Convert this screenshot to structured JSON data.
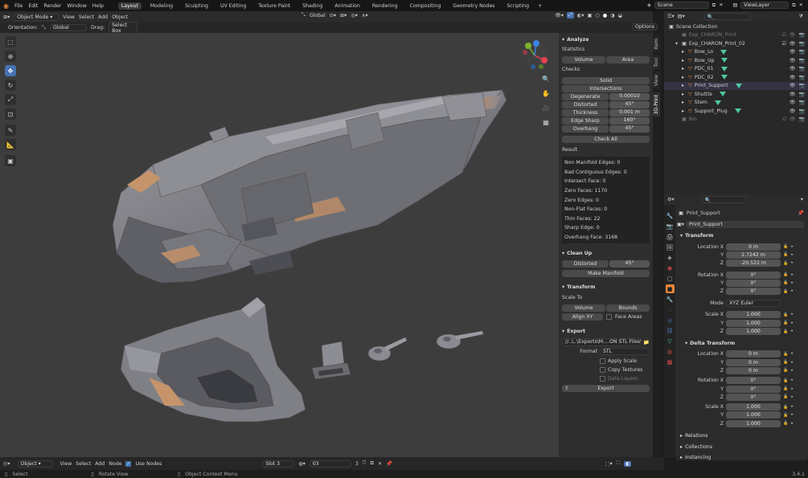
{
  "topbar": {
    "menu": [
      "File",
      "Edit",
      "Render",
      "Window",
      "Help"
    ],
    "workspaces": [
      "Layout",
      "Modeling",
      "Sculpting",
      "UV Editing",
      "Texture Paint",
      "Shading",
      "Animation",
      "Rendering",
      "Compositing",
      "Geometry Nodes",
      "Scripting"
    ],
    "active_workspace": "Layout",
    "add_tab": "+",
    "scene": "Scene",
    "view_layer": "ViewLayer"
  },
  "viewport_header": {
    "mode": "Object Mode",
    "menus": [
      "View",
      "Select",
      "Add",
      "Object"
    ],
    "transform_orientation": "Global"
  },
  "tool_header": {
    "orientation_label": "Orientation:",
    "orientation_value": "Global",
    "drag_label": "Drag:",
    "drag_value": "Select Box",
    "options": "Options"
  },
  "sidebar_tabs": [
    "Item",
    "Tool",
    "View",
    "3D-Print"
  ],
  "print3d": {
    "analyze_title": "Analyze",
    "statistics_label": "Statistics",
    "volume_btn": "Volume",
    "area_btn": "Area",
    "checks_label": "Checks",
    "solid_btn": "Solid",
    "intersections_btn": "Intersections",
    "checks": [
      {
        "label": "Degenerate",
        "value": "0.00010"
      },
      {
        "label": "Distorted",
        "value": "45°"
      },
      {
        "label": "Thickness",
        "value": "0.001 m"
      },
      {
        "label": "Edge Sharp",
        "value": "160°"
      },
      {
        "label": "Overhang",
        "value": "45°"
      }
    ],
    "check_all_btn": "Check All",
    "result_label": "Result",
    "results": [
      "Non Manifold Edges: 0",
      "Bad Contiguous Edges: 0",
      "Intersect Face: 0",
      "Zero Faces: 1170",
      "Zero Edges: 0",
      "Non-Flat Faces: 0",
      "Thin Faces: 22",
      "Sharp Edge: 0",
      "Overhang Face: 3168"
    ],
    "cleanup_title": "Clean Up",
    "distorted_label": "Distorted",
    "distorted_value": "45°",
    "make_manifold_btn": "Make Manifold",
    "transform_title": "Transform",
    "scale_to_label": "Scale To",
    "scale_volume_btn": "Volume",
    "scale_bounds_btn": "Bounds",
    "align_xy_btn": "Align XY",
    "face_areas_label": "Face Areas",
    "export_title": "Export",
    "export_path": "//..\\..\\Exports\\M....ON STL Files\\02\\",
    "format_label": "Format",
    "format_value": "STL",
    "apply_scale_label": "Apply Scale",
    "copy_textures_label": "Copy Textures",
    "data_layers_label": "Data Layers",
    "export_btn": "Export"
  },
  "outliner": {
    "root": "Scene Collection",
    "items": [
      {
        "label": "Exp_CHARON_Print",
        "level": 1,
        "dim": true
      },
      {
        "label": "Exp_CHARON_Print_02",
        "level": 1,
        "dim": false
      },
      {
        "label": "Bow_Lo",
        "level": 2,
        "dim": false
      },
      {
        "label": "Bow_Up",
        "level": 2,
        "dim": false
      },
      {
        "label": "PDC_01",
        "level": 2,
        "dim": false
      },
      {
        "label": "PDC_02",
        "level": 2,
        "dim": false
      },
      {
        "label": "Print_Support",
        "level": 2,
        "dim": false
      },
      {
        "label": "Shuttle",
        "level": 2,
        "dim": false
      },
      {
        "label": "Stem",
        "level": 2,
        "dim": false
      },
      {
        "label": "Support_Plug",
        "level": 2,
        "dim": false
      },
      {
        "label": "Bin",
        "level": 1,
        "dim": true
      }
    ]
  },
  "properties": {
    "object_name": "Print_Support",
    "object_name_field": "Print_Support",
    "transform_title": "Transform",
    "location_x_label": "Location X",
    "location": [
      "0 m",
      "2.7242 m",
      "-20.522 m"
    ],
    "rotation_x_label": "Rotation X",
    "rotation": [
      "0°",
      "0°",
      "0°"
    ],
    "mode_label": "Mode",
    "mode_value": "XYZ Euler",
    "scale_x_label": "Scale X",
    "scale": [
      "1.000",
      "1.000",
      "1.000"
    ],
    "delta_transform_title": "Delta Transform",
    "delta_location": [
      "0 m",
      "0 m",
      "0 m"
    ],
    "delta_rotation": [
      "0°",
      "0°",
      "0°"
    ],
    "delta_scale": [
      "1.000",
      "1.000",
      "1.000"
    ],
    "y_label": "Y",
    "z_label": "Z",
    "relations_title": "Relations",
    "collections_title": "Collections",
    "instancing_title": "Instancing"
  },
  "bottom_editor": {
    "editor_type": "Object",
    "menus": [
      "View",
      "Select",
      "Add",
      "Node"
    ],
    "use_nodes_label": "Use Nodes",
    "slot": "Slot 3",
    "material": "03"
  },
  "statusbar": {
    "select": "Select",
    "rotate_view": "Rotate View",
    "context_menu": "Object Context Menu",
    "version": "3.4.1"
  },
  "colors": {
    "accent": "#4772b3",
    "object_orange": "#e8863a",
    "mesh_green": "#4ec9a0",
    "viewport_bg": "#3d3d3d",
    "axis_x": "#e8414f",
    "axis_y": "#7db32d",
    "axis_z": "#3a83e0"
  }
}
